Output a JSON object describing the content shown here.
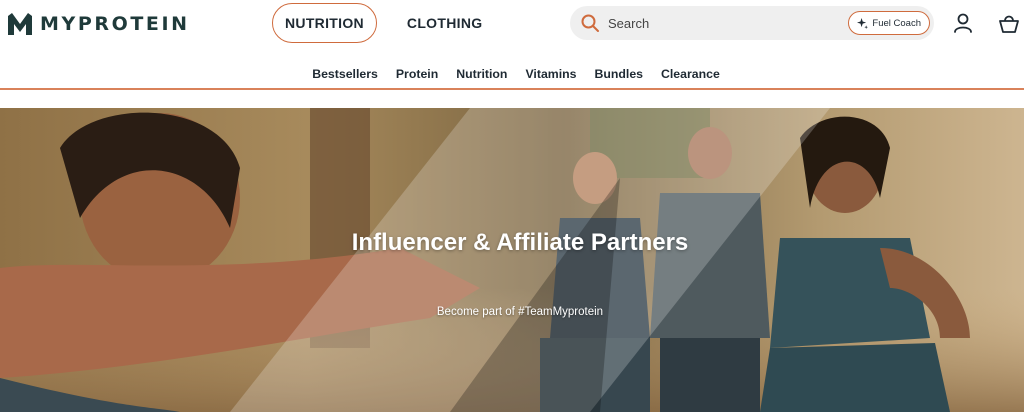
{
  "brand": {
    "name": "MYPROTEIN",
    "logo_icon": "myprotein-m-logo-icon"
  },
  "main_nav": [
    {
      "label": "NUTRITION",
      "active": true
    },
    {
      "label": "CLOTHING",
      "active": false
    }
  ],
  "search": {
    "placeholder": "Search",
    "icon": "search-icon"
  },
  "fuel_coach": {
    "label": "Fuel Coach",
    "icon": "sparkle-icon"
  },
  "header_icons": [
    "account-icon",
    "basket-icon"
  ],
  "subnav": [
    "Bestsellers",
    "Protein",
    "Nutrition",
    "Vitamins",
    "Bundles",
    "Clearance"
  ],
  "hero": {
    "title": "Influencer & Affiliate Partners",
    "subtitle": "Become part of #TeamMyprotein"
  },
  "colors": {
    "accent": "#cf6b3d",
    "brand": "#1f3a3a",
    "search_bg": "#efefef"
  }
}
